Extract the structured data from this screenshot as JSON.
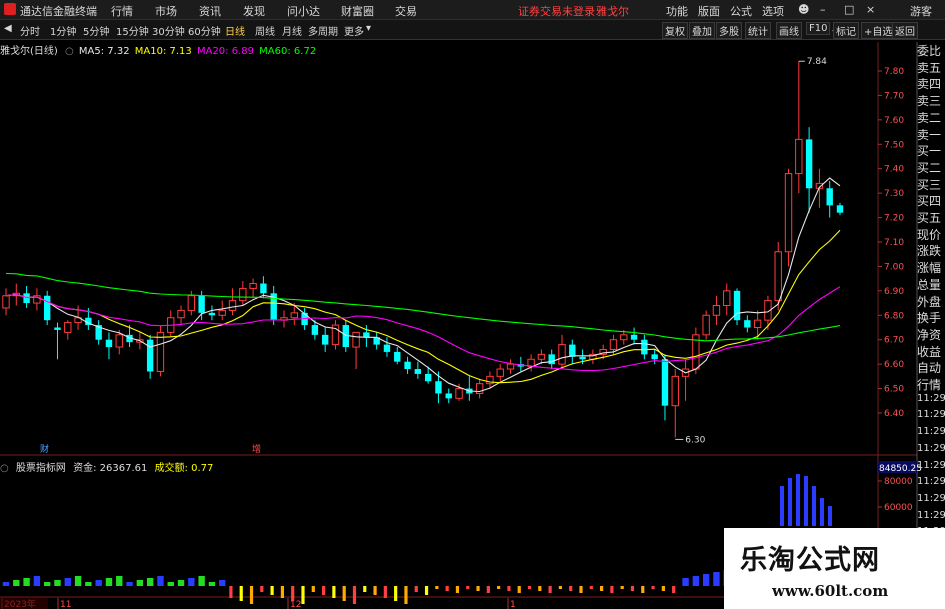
{
  "app": {
    "title": "通达信金融终端",
    "menu": [
      "行情",
      "市场",
      "资讯",
      "发现",
      "问小达",
      "财富圈",
      "交易"
    ],
    "notice": "证券交易未登录",
    "stock_name": "雅戈尔",
    "right_menu": [
      "功能",
      "版面",
      "公式",
      "选项"
    ],
    "guest": "游客"
  },
  "toolbar": {
    "periods": [
      "分时",
      "1分钟",
      "5分钟",
      "15分钟",
      "30分钟",
      "60分钟",
      "日线",
      "周线",
      "月线",
      "多周期",
      "更多"
    ],
    "active": "日线",
    "right": [
      "复权",
      "叠加",
      "多股",
      "统计",
      "画线",
      "F10",
      "标记",
      "+自选",
      "返回"
    ]
  },
  "ma_line": {
    "name": "雅戈尔(日线)",
    "ma5": "MA5: 7.32",
    "ma10": "MA10: 7.13",
    "ma20": "MA20: 6.89",
    "ma60": "MA60: 6.72"
  },
  "indicator_line": {
    "name": "股票指标网",
    "fund": "资金: 26367.61",
    "ratio": "成交额: 0.77"
  },
  "price_axis": [
    "7.80",
    "7.70",
    "7.60",
    "7.50",
    "7.40",
    "7.30",
    "7.20",
    "7.10",
    "7.00",
    "6.90",
    "6.80",
    "6.70",
    "6.60",
    "6.50",
    "6.40"
  ],
  "volume_axis": {
    "top": "84850.25",
    "ticks": [
      "80000",
      "60000"
    ]
  },
  "right_panel": [
    "委比",
    "卖五",
    "卖四",
    "卖三",
    "卖二",
    "卖一",
    "买一",
    "买二",
    "买三",
    "买四",
    "买五",
    "现价",
    "涨跌",
    "涨幅",
    "总量",
    "外盘",
    "换手",
    "净资",
    "收益",
    "自动",
    "行情",
    "11:29",
    "11:29",
    "11:29",
    "11:29",
    "11:29",
    "11:29",
    "11:29",
    "11:29",
    "11:29"
  ],
  "price_annotations": {
    "high": "7.84",
    "low": "6.30"
  },
  "event_markers": [
    "财",
    "增"
  ],
  "date_axis": [
    "2023年",
    "11",
    "12",
    "1"
  ],
  "colors": {
    "up": "#ff3c3c",
    "down": "#00ffff",
    "ma5": "#e8e8e8",
    "ma10": "#ffff00",
    "ma20": "#ff00ff",
    "ma60": "#00ff00"
  },
  "logo": {
    "cn": "乐淘公式网",
    "url": "www.60lt.com"
  },
  "chart_data": {
    "type": "candlestick",
    "ylim": [
      6.3,
      7.88
    ],
    "candles": [
      [
        6.83,
        6.91,
        6.8,
        6.88
      ],
      [
        6.88,
        6.93,
        6.84,
        6.89
      ],
      [
        6.89,
        6.92,
        6.83,
        6.85
      ],
      [
        6.85,
        6.91,
        6.82,
        6.88
      ],
      [
        6.88,
        6.9,
        6.76,
        6.78
      ],
      [
        6.75,
        6.77,
        6.62,
        6.74
      ],
      [
        6.73,
        6.78,
        6.7,
        6.77
      ],
      [
        6.77,
        6.84,
        6.74,
        6.79
      ],
      [
        6.79,
        6.83,
        6.74,
        6.76
      ],
      [
        6.76,
        6.78,
        6.68,
        6.7
      ],
      [
        6.7,
        6.73,
        6.62,
        6.67
      ],
      [
        6.67,
        6.74,
        6.64,
        6.72
      ],
      [
        6.72,
        6.76,
        6.67,
        6.69
      ],
      [
        6.69,
        6.73,
        6.66,
        6.7
      ],
      [
        6.7,
        6.72,
        6.54,
        6.57
      ],
      [
        6.57,
        6.76,
        6.55,
        6.73
      ],
      [
        6.73,
        6.82,
        6.71,
        6.79
      ],
      [
        6.79,
        6.84,
        6.76,
        6.82
      ],
      [
        6.82,
        6.9,
        6.8,
        6.88
      ],
      [
        6.88,
        6.9,
        6.78,
        6.81
      ],
      [
        6.81,
        6.84,
        6.78,
        6.8
      ],
      [
        6.8,
        6.86,
        6.78,
        6.82
      ],
      [
        6.82,
        6.91,
        6.8,
        6.86
      ],
      [
        6.86,
        6.94,
        6.84,
        6.91
      ],
      [
        6.91,
        6.95,
        6.87,
        6.93
      ],
      [
        6.93,
        6.96,
        6.87,
        6.89
      ],
      [
        6.89,
        6.92,
        6.76,
        6.78
      ],
      [
        6.78,
        6.82,
        6.75,
        6.79
      ],
      [
        6.79,
        6.85,
        6.76,
        6.81
      ],
      [
        6.81,
        6.83,
        6.74,
        6.76
      ],
      [
        6.76,
        6.78,
        6.7,
        6.72
      ],
      [
        6.72,
        6.75,
        6.65,
        6.68
      ],
      [
        6.68,
        6.78,
        6.66,
        6.76
      ],
      [
        6.76,
        6.78,
        6.65,
        6.67
      ],
      [
        6.67,
        6.7,
        6.58,
        6.73
      ],
      [
        6.73,
        6.76,
        6.67,
        6.71
      ],
      [
        6.71,
        6.73,
        6.66,
        6.68
      ],
      [
        6.68,
        6.71,
        6.63,
        6.65
      ],
      [
        6.65,
        6.67,
        6.6,
        6.61
      ],
      [
        6.61,
        6.63,
        6.56,
        6.58
      ],
      [
        6.58,
        6.61,
        6.54,
        6.56
      ],
      [
        6.56,
        6.59,
        6.52,
        6.53
      ],
      [
        6.53,
        6.57,
        6.44,
        6.48
      ],
      [
        6.48,
        6.5,
        6.44,
        6.46
      ],
      [
        6.46,
        6.52,
        6.45,
        6.5
      ],
      [
        6.5,
        6.55,
        6.45,
        6.48
      ],
      [
        6.48,
        6.54,
        6.46,
        6.52
      ],
      [
        6.52,
        6.57,
        6.5,
        6.55
      ],
      [
        6.55,
        6.6,
        6.53,
        6.58
      ],
      [
        6.58,
        6.62,
        6.56,
        6.6
      ],
      [
        6.6,
        6.63,
        6.57,
        6.59
      ],
      [
        6.59,
        6.64,
        6.57,
        6.62
      ],
      [
        6.62,
        6.66,
        6.6,
        6.64
      ],
      [
        6.64,
        6.66,
        6.58,
        6.6
      ],
      [
        6.6,
        6.72,
        6.58,
        6.68
      ],
      [
        6.68,
        6.7,
        6.6,
        6.63
      ],
      [
        6.63,
        6.66,
        6.6,
        6.62
      ],
      [
        6.62,
        6.66,
        6.6,
        6.64
      ],
      [
        6.64,
        6.68,
        6.62,
        6.66
      ],
      [
        6.66,
        6.72,
        6.64,
        6.7
      ],
      [
        6.7,
        6.74,
        6.68,
        6.72
      ],
      [
        6.72,
        6.75,
        6.68,
        6.7
      ],
      [
        6.7,
        6.72,
        6.62,
        6.64
      ],
      [
        6.64,
        6.66,
        6.6,
        6.62
      ],
      [
        6.62,
        6.64,
        6.37,
        6.43
      ],
      [
        6.43,
        6.58,
        6.3,
        6.55
      ],
      [
        6.55,
        6.62,
        6.45,
        6.58
      ],
      [
        6.58,
        6.75,
        6.56,
        6.72
      ],
      [
        6.72,
        6.82,
        6.7,
        6.8
      ],
      [
        6.8,
        6.88,
        6.76,
        6.84
      ],
      [
        6.84,
        6.93,
        6.8,
        6.9
      ],
      [
        6.9,
        6.91,
        6.76,
        6.78
      ],
      [
        6.78,
        6.8,
        6.73,
        6.75
      ],
      [
        6.75,
        6.82,
        6.7,
        6.78
      ],
      [
        6.78,
        6.88,
        6.74,
        6.86
      ],
      [
        6.86,
        7.1,
        6.82,
        7.06
      ],
      [
        7.06,
        7.4,
        7.0,
        7.38
      ],
      [
        7.38,
        7.84,
        7.3,
        7.52
      ],
      [
        7.52,
        7.57,
        7.22,
        7.32
      ],
      [
        7.32,
        7.4,
        7.24,
        7.34
      ],
      [
        7.32,
        7.35,
        7.2,
        7.25
      ],
      [
        7.25,
        7.26,
        7.21,
        7.22
      ]
    ]
  }
}
